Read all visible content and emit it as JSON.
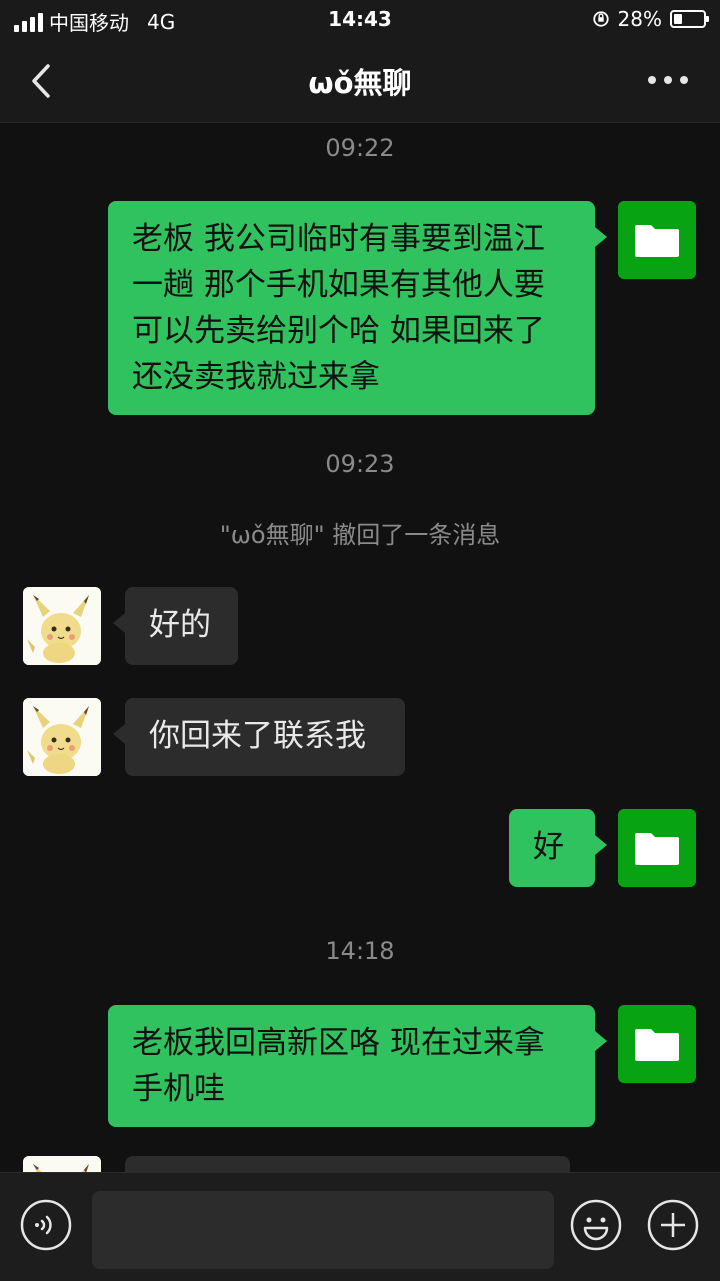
{
  "status_bar": {
    "carrier": "中国移动",
    "network": "4G",
    "time": "14:43",
    "battery": "28%",
    "battery_level": 0.28
  },
  "header": {
    "title": "ωǒ無聊"
  },
  "messages": {
    "ts1": "09:22",
    "m1": "老板 我公司临时有事要到温江一趟 那个手机如果有其他人要可以先卖给别个哈 如果回来了还没卖我就过来拿",
    "ts2": "09:23",
    "recall": "\"ωǒ無聊\" 撤回了一条消息",
    "m2": "好的",
    "m3": "你回来了联系我",
    "m4": "好",
    "ts3": "14:18",
    "m5": "老板我回高新区咯 现在过来拿手机哇"
  },
  "colors": {
    "self_bubble": "#30c25e",
    "other_bubble": "#2c2c2c",
    "self_avatar": "#07a312",
    "background": "#111111"
  },
  "icons": [
    "back-arrow-icon",
    "more-icon",
    "folder-icon",
    "pikachu-avatar",
    "voice-icon",
    "emoji-icon",
    "plus-icon"
  ]
}
